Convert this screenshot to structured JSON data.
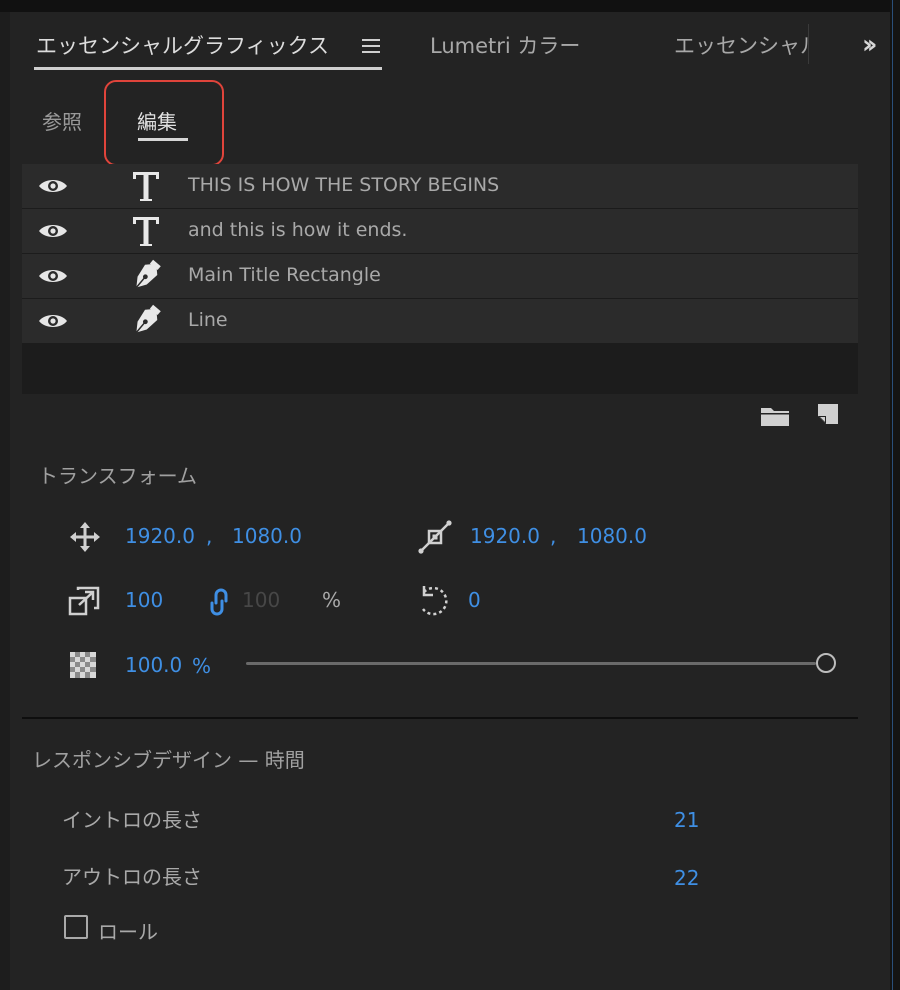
{
  "tabs": {
    "active": "エッセンシャルグラフィックス",
    "lumetri": "Lumetri カラー",
    "essential_truncated": "エッセンシャル"
  },
  "subtabs": {
    "browse": "参照",
    "edit": "編集"
  },
  "layers": [
    {
      "name": "THIS IS HOW THE STORY BEGINS",
      "type": "text-icon"
    },
    {
      "name": "and this is how it ends.",
      "type": "text-icon"
    },
    {
      "name": "Main Title Rectangle",
      "type": "pen-icon"
    },
    {
      "name": "Line",
      "type": "pen-icon"
    }
  ],
  "transform": {
    "title": "トランスフォーム",
    "position_x": "1920.0",
    "position_sep": ",",
    "position_y": "1080.0",
    "anchor_x": "1920.0",
    "anchor_sep": ",",
    "anchor_y": "1080.0",
    "scale_width": "100",
    "scale_height": "100",
    "scale_unit": "%",
    "rotation": "0",
    "opacity": "100.0",
    "opacity_unit": "%"
  },
  "responsive": {
    "title": "レスポンシブデザイン — 時間",
    "intro_label": "イントロの長さ",
    "intro_value": "21",
    "outro_label": "アウトロの長さ",
    "outro_value": "22",
    "roll_label": "ロール"
  },
  "colors": {
    "accent_blue": "#3f8fe4",
    "highlight_red": "#e0443b",
    "panel_bg": "#232323"
  }
}
